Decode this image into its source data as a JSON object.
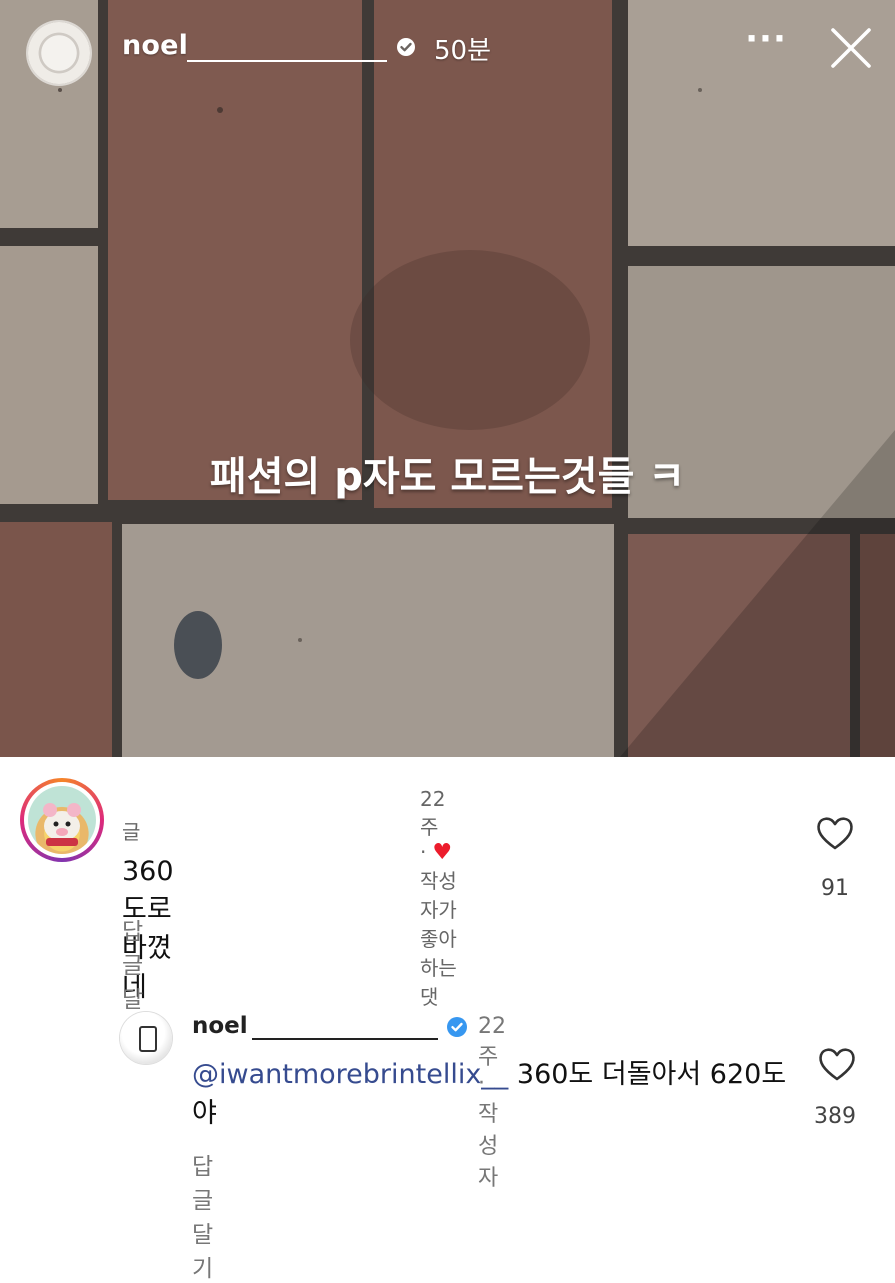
{
  "story": {
    "username": "noel",
    "time": "50분",
    "more_icon": "more-dots-icon",
    "close_icon": "close-icon",
    "caption": "패션의 p자도 모르는것들 ㅋ"
  },
  "comments": [
    {
      "meta": "22주 ·",
      "liked_by_author_label": "작성자가 좋아하는 댓",
      "username": "글",
      "text": "360도로 바꼈네",
      "reply_label": "답글 달기",
      "like_count": "91"
    },
    {
      "username": "noel",
      "meta": "22주 · 작성자",
      "mention": "@iwantmorebrintellix__",
      "text": " 360도 더돌아서 620도야",
      "reply_label": "답글 달기",
      "like_count": "389"
    }
  ],
  "colors": {
    "verified": "#3797f0",
    "heart": "#ec1c2c",
    "mention": "#364b8f"
  }
}
